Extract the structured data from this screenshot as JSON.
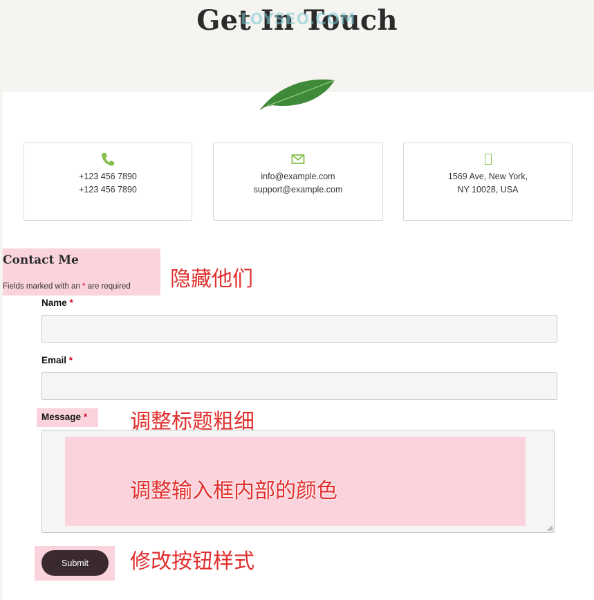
{
  "page": {
    "title": "Get In Touch",
    "watermark": "LOYSEO.COM"
  },
  "contact_info": [
    {
      "icon": "phone-icon",
      "line1": "+123 456 7890",
      "line2": "+123 456 7890"
    },
    {
      "icon": "envelope-icon",
      "line1": "info@example.com",
      "line2": "support@example.com"
    },
    {
      "icon": "map-marker-icon",
      "line1": "1569 Ave, New York,",
      "line2": "NY 10028, USA"
    }
  ],
  "form": {
    "heading": "Contact Me",
    "required_note_prefix": "Fields marked with an ",
    "required_star": "*",
    "required_note_suffix": " are required",
    "fields": [
      {
        "label": "Name",
        "required": "*",
        "value": ""
      },
      {
        "label": "Email",
        "required": "*",
        "value": ""
      },
      {
        "label": "Message",
        "required": "*",
        "value": ""
      }
    ],
    "submit_label": "Submit"
  },
  "annotations": {
    "hide_them": "隐藏他们",
    "adjust_label_weight": "调整标题粗细",
    "adjust_input_color": "调整输入框内部的颜色",
    "modify_button_style": "修改按钮样式"
  },
  "colors": {
    "accent": "#86c04c",
    "required_star": "#d0021b",
    "annotation_highlight": "#fad3dd",
    "annotation_text": "#e0302e",
    "button": "#3a2a2f",
    "input_bg": "#f5f5f5"
  }
}
